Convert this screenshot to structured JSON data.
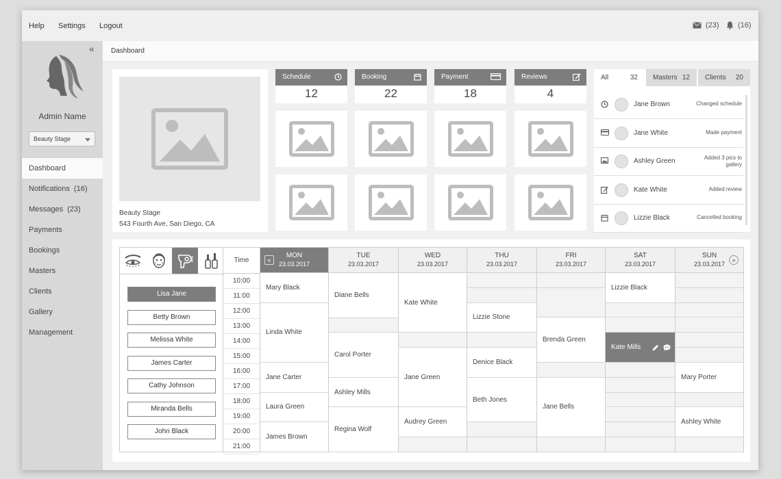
{
  "topbar": {
    "nav": [
      "Help",
      "Settings",
      "Logout"
    ],
    "messages_count": "(23)",
    "notifications_count": "(16)"
  },
  "sidebar": {
    "admin_name": "Admin Name",
    "stage_selected": "Beauty Stage",
    "items": [
      {
        "label": "Dashboard",
        "count": ""
      },
      {
        "label": "Notifications",
        "count": "(16)"
      },
      {
        "label": "Messages",
        "count": "(23)"
      },
      {
        "label": "Payments",
        "count": ""
      },
      {
        "label": "Bookings",
        "count": ""
      },
      {
        "label": "Masters",
        "count": ""
      },
      {
        "label": "Clients",
        "count": ""
      },
      {
        "label": "Gallery",
        "count": ""
      },
      {
        "label": "Management",
        "count": ""
      }
    ]
  },
  "breadcrumb": "Dashboard",
  "profile": {
    "name": "Beauty Stage",
    "address": "543 Fourth Ave, San Diego, CA"
  },
  "stats": [
    {
      "label": "Schedule",
      "value": "12",
      "icon": "clock-icon"
    },
    {
      "label": "Booking",
      "value": "22",
      "icon": "calendar-icon"
    },
    {
      "label": "Payment",
      "value": "18",
      "icon": "card-icon"
    },
    {
      "label": "Reviews",
      "value": "4",
      "icon": "edit-icon"
    }
  ],
  "activity": {
    "tabs": [
      {
        "label": "All",
        "count": "32"
      },
      {
        "label": "Masters",
        "count": "12"
      },
      {
        "label": "Clients",
        "count": "20"
      }
    ],
    "rows": [
      {
        "icon": "clock-icon",
        "name": "Jane Brown",
        "desc": "Changed schedule"
      },
      {
        "icon": "card-icon",
        "name": "Jane White",
        "desc": "Made payment"
      },
      {
        "icon": "image-icon",
        "name": "Ashley Green",
        "desc": "Added 3 pics to gallery"
      },
      {
        "icon": "edit-icon",
        "name": "Kate White",
        "desc": "Added review"
      },
      {
        "icon": "calendar-icon",
        "name": "Lizzie Black",
        "desc": "Cancelled booking"
      }
    ]
  },
  "schedule": {
    "time_header": "Time",
    "times": [
      "10:00",
      "11:00",
      "12:00",
      "13:00",
      "14:00",
      "15:00",
      "16:00",
      "17:00",
      "18:00",
      "19:00",
      "20:00",
      "21:00"
    ],
    "masters": [
      {
        "name": "Lisa Jane",
        "active": true
      },
      {
        "name": "Betty Brown",
        "active": false
      },
      {
        "name": "Melissa White",
        "active": false
      },
      {
        "name": "James Carter",
        "active": false
      },
      {
        "name": "Cathy Johnson",
        "active": false
      },
      {
        "name": "Miranda Bells",
        "active": false
      },
      {
        "name": "John Black",
        "active": false
      }
    ],
    "days": [
      {
        "day": "MON",
        "date": "23.03.2017",
        "active": true,
        "slots": [
          {
            "name": "Mary Black",
            "h": 2
          },
          {
            "name": "Linda White",
            "h": 4
          },
          {
            "name": "Jane Carter",
            "h": 2
          },
          {
            "name": "Laura Green",
            "h": 2
          },
          {
            "name": "James Brown",
            "h": 2
          }
        ]
      },
      {
        "day": "TUE",
        "date": "23.03.2017",
        "active": false,
        "slots": [
          {
            "name": "Diane Bells",
            "h": 3
          },
          {
            "name": "",
            "h": 1
          },
          {
            "name": "Carol Porter",
            "h": 3
          },
          {
            "name": "Ashley Mills",
            "h": 2
          },
          {
            "name": "Regina Wolf",
            "h": 3
          }
        ]
      },
      {
        "day": "WED",
        "date": "23.03.2017",
        "active": false,
        "slots": [
          {
            "name": "Kate White",
            "h": 4
          },
          {
            "name": "",
            "h": 1
          },
          {
            "name": "Jane Green",
            "h": 4
          },
          {
            "name": "Audrey Green",
            "h": 2
          },
          {
            "name": "",
            "h": 1
          }
        ]
      },
      {
        "day": "THU",
        "date": "23.03.2017",
        "active": false,
        "slots": [
          {
            "name": "",
            "h": 1
          },
          {
            "name": "",
            "h": 1
          },
          {
            "name": "Lizzie Stone",
            "h": 2
          },
          {
            "name": "",
            "h": 1
          },
          {
            "name": "Denice Black",
            "h": 2
          },
          {
            "name": "Beth Jones",
            "h": 3
          },
          {
            "name": "",
            "h": 1
          },
          {
            "name": "",
            "h": 1
          }
        ]
      },
      {
        "day": "FRI",
        "date": "23.03.2017",
        "active": false,
        "slots": [
          {
            "name": "",
            "h": 1
          },
          {
            "name": "",
            "h": 2
          },
          {
            "name": "Brenda Green",
            "h": 3
          },
          {
            "name": "",
            "h": 1
          },
          {
            "name": "Jane Bells",
            "h": 4
          },
          {
            "name": "",
            "h": 1
          }
        ]
      },
      {
        "day": "SAT",
        "date": "23.03.2017",
        "active": false,
        "slots": [
          {
            "name": "Lizzie Black",
            "h": 2
          },
          {
            "name": "",
            "h": 1
          },
          {
            "name": "",
            "h": 1
          },
          {
            "name": "Kate Mills",
            "h": 2,
            "active": true
          },
          {
            "name": "",
            "h": 1
          },
          {
            "name": "",
            "h": 1
          },
          {
            "name": "",
            "h": 1
          },
          {
            "name": "",
            "h": 1
          },
          {
            "name": "",
            "h": 1
          },
          {
            "name": "",
            "h": 1
          }
        ]
      },
      {
        "day": "SUN",
        "date": "23.03.2017",
        "active": false,
        "slots": [
          {
            "name": "",
            "h": 1
          },
          {
            "name": "",
            "h": 1
          },
          {
            "name": "",
            "h": 1
          },
          {
            "name": "",
            "h": 1
          },
          {
            "name": "",
            "h": 1
          },
          {
            "name": "",
            "h": 1
          },
          {
            "name": "Mary Porter",
            "h": 2
          },
          {
            "name": "",
            "h": 1
          },
          {
            "name": "Ashley White",
            "h": 2
          },
          {
            "name": "",
            "h": 1
          }
        ]
      }
    ]
  },
  "colors": {
    "accent": "#7d7d7d",
    "sidebar": "#d8d8d8",
    "background": "#f0f0f0"
  }
}
